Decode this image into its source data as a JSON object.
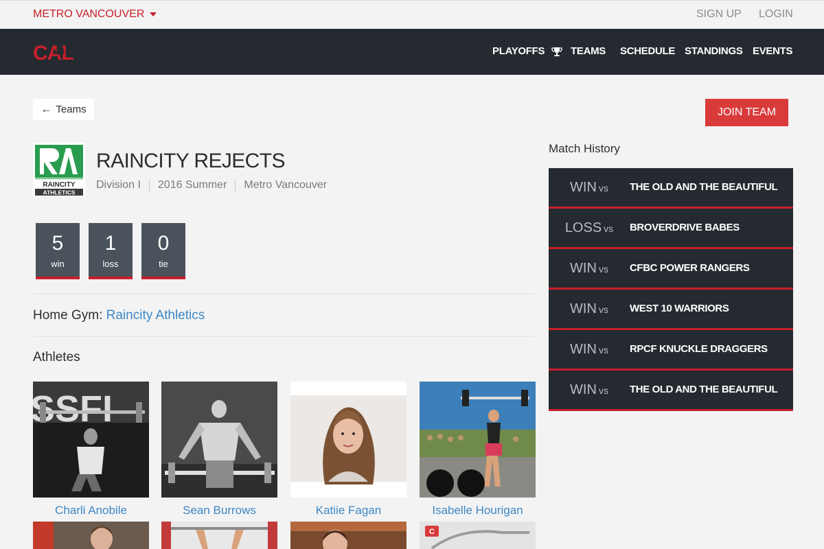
{
  "topbar": {
    "region": "METRO VANCOUVER",
    "signup": "SIGN UP",
    "login": "LOGIN"
  },
  "nav": {
    "logo_text": "CAL",
    "items": [
      "PLAYOFFS",
      "TEAMS",
      "SCHEDULE",
      "STANDINGS",
      "EVENTS"
    ]
  },
  "back_label": "Teams",
  "join_label": "JOIN TEAM",
  "team": {
    "name": "RAINCITY REJECTS",
    "division": "Division I",
    "season": "2016 Summer",
    "region": "Metro Vancouver",
    "logo_text_1": "RAINCITY",
    "logo_text_2": "ATHLETICS"
  },
  "record": {
    "win": {
      "value": "5",
      "label": "win"
    },
    "loss": {
      "value": "1",
      "label": "loss"
    },
    "tie": {
      "value": "0",
      "label": "tie"
    }
  },
  "home_gym": {
    "label": "Home Gym:",
    "value": "Raincity Athletics"
  },
  "athletes_title": "Athletes",
  "athletes": [
    {
      "name": "Charli Anobile"
    },
    {
      "name": "Sean Burrows"
    },
    {
      "name": "Katiie Fagan"
    },
    {
      "name": "Isabelle Hourigan"
    }
  ],
  "match_history": {
    "title": "Match History",
    "vs": "vs",
    "matches": [
      {
        "result": "WIN",
        "opponent": "THE OLD AND THE BEAUTIFUL"
      },
      {
        "result": "LOSS",
        "opponent": "BROVERDRIVE BABES"
      },
      {
        "result": "WIN",
        "opponent": "CFBC POWER RANGERS"
      },
      {
        "result": "WIN",
        "opponent": "WEST 10 WARRIORS"
      },
      {
        "result": "WIN",
        "opponent": "RPCF KNUCKLE DRAGGERS"
      },
      {
        "result": "WIN",
        "opponent": "THE OLD AND THE BEAUTIFUL"
      }
    ]
  },
  "colors": {
    "brand_red": "#c8202a",
    "nav_dark": "#252a31",
    "link_blue": "#3d87c5",
    "join_red": "#d93b3b"
  }
}
